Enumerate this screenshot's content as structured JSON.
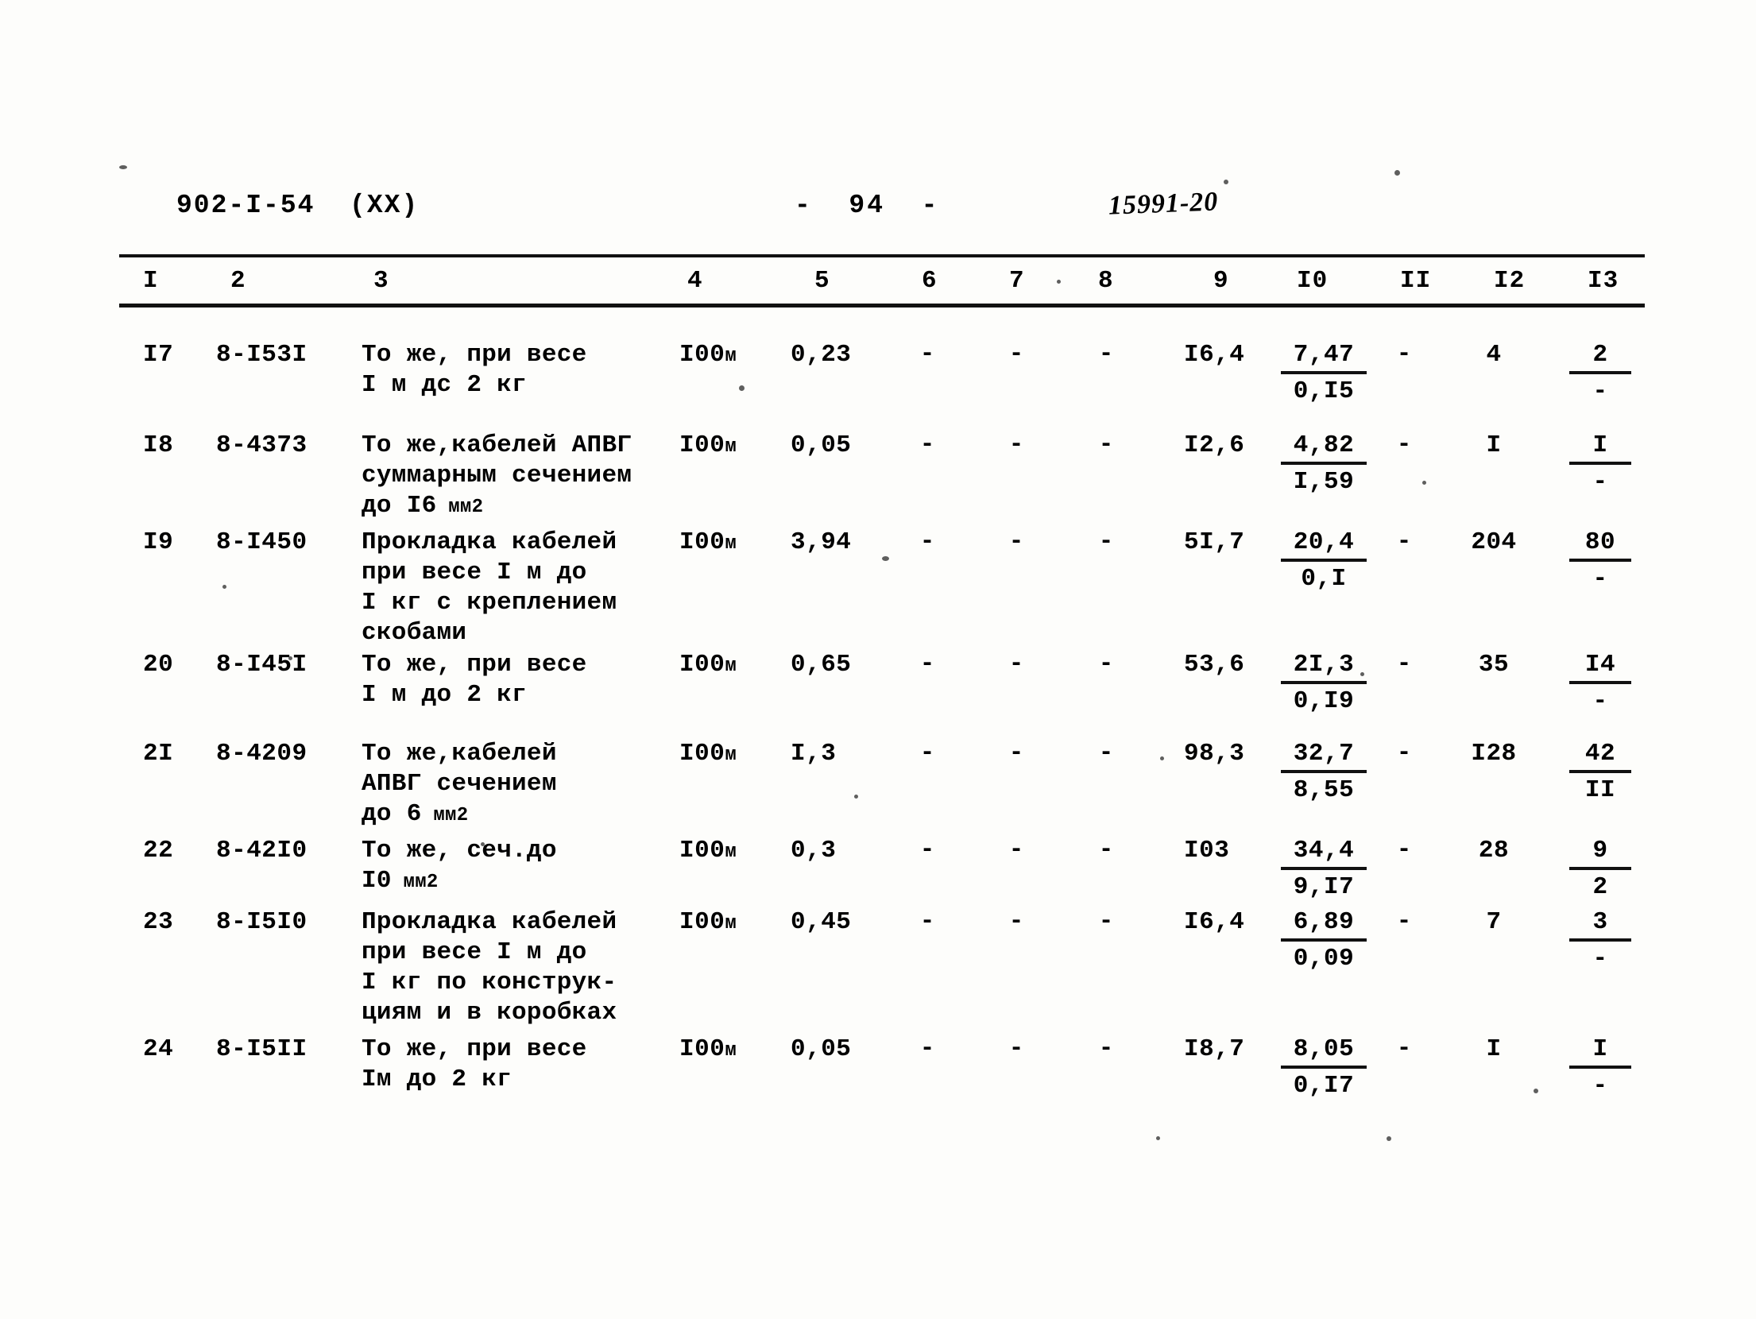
{
  "header": {
    "doc_code": "902-I-54  (XX)",
    "page_label": "-  94  -",
    "hand_note": "15991-20"
  },
  "table": {
    "column_headers": [
      "I",
      "2",
      "3",
      "4",
      "5",
      "6",
      "7",
      "8",
      "9",
      "I0",
      "II",
      "I2",
      "I3"
    ],
    "rows": [
      {
        "c1": "I7",
        "c2": "8-I53I",
        "c3": "То же, при весе\nI м дс 2 кг",
        "c4": "I00",
        "c4_unit": "м",
        "c5": "0,23",
        "c6": "-",
        "c7": "-",
        "c8": "-",
        "c9": "I6,4",
        "c10_top": "7,47",
        "c10_bot": "0,I5",
        "c11": "-",
        "c12": "4",
        "c13_top": "2",
        "c13_bot": "-"
      },
      {
        "c1": "I8",
        "c2": "8-4373",
        "c3": "То же,кабелей АПВГ\nсуммарным сечением\nдо I6 мм2",
        "c4": "I00",
        "c4_unit": "м",
        "c5": "0,05",
        "c6": "-",
        "c7": "-",
        "c8": "-",
        "c9": "I2,6",
        "c10_top": "4,82",
        "c10_bot": "I,59",
        "c11": "-",
        "c12": "I",
        "c13_top": "I",
        "c13_bot": "-"
      },
      {
        "c1": "I9",
        "c2": "8-I450",
        "c3": "Прокладка кабелей\nпри весе I м до\nI кг с креплением\nскобами",
        "c4": "I00",
        "c4_unit": "м",
        "c5": "3,94",
        "c6": "-",
        "c7": "-",
        "c8": "-",
        "c9": "5I,7",
        "c10_top": "20,4",
        "c10_bot": "0,I",
        "c11": "-",
        "c12": "204",
        "c13_top": "80",
        "c13_bot": "-"
      },
      {
        "c1": "20",
        "c2": "8-I45I",
        "c3": "То же, при весе\nI м до 2 кг",
        "c4": "I00",
        "c4_unit": "м",
        "c5": "0,65",
        "c6": "-",
        "c7": "-",
        "c8": "-",
        "c9": "53,6",
        "c10_top": "2I,3",
        "c10_bot": "0,I9",
        "c11": "-",
        "c12": "35",
        "c13_top": "I4",
        "c13_bot": "-"
      },
      {
        "c1": "2I",
        "c2": "8-4209",
        "c3": "То же,кабелей\nАПВГ сечением\nдо 6 мм2",
        "c4": "I00",
        "c4_unit": "м",
        "c5": "I,3",
        "c6": "-",
        "c7": "-",
        "c8": "-",
        "c9": "98,3",
        "c10_top": "32,7",
        "c10_bot": "8,55",
        "c11": "-",
        "c12": "I28",
        "c13_top": "42",
        "c13_bot": "II"
      },
      {
        "c1": "22",
        "c2": "8-42I0",
        "c3": "То же, сеч.до\nI0 мм2",
        "c4": "I00",
        "c4_unit": "м",
        "c5": "0,3",
        "c6": "-",
        "c7": "-",
        "c8": "-",
        "c9": "I03",
        "c10_top": "34,4",
        "c10_bot": "9,I7",
        "c11": "-",
        "c12": "28",
        "c13_top": "9",
        "c13_bot": "2"
      },
      {
        "c1": "23",
        "c2": "8-I5I0",
        "c3": "Прокладка кабелей\nпри весе I м до\nI кг по конструк-\nциям и в коробках",
        "c4": "I00",
        "c4_unit": "м",
        "c5": "0,45",
        "c6": "-",
        "c7": "-",
        "c8": "-",
        "c9": "I6,4",
        "c10_top": "6,89",
        "c10_bot": "0,09",
        "c11": "-",
        "c12": "7",
        "c13_top": "3",
        "c13_bot": "-"
      },
      {
        "c1": "24",
        "c2": "8-I5II",
        "c3": "То же, при весе\nIм до 2 кг",
        "c4": "I00",
        "c4_unit": "м",
        "c5": "0,05",
        "c6": "-",
        "c7": "-",
        "c8": "-",
        "c9": "I8,7",
        "c10_top": "8,05",
        "c10_bot": "0,I7",
        "c11": "-",
        "c12": "I",
        "c13_top": "I",
        "c13_bot": "-"
      }
    ]
  }
}
